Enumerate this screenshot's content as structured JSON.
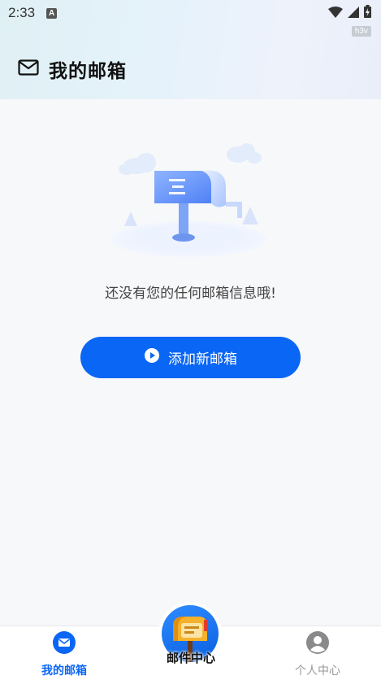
{
  "status_bar": {
    "time": "2:33",
    "notification_badge": "A",
    "watermark": "h3v"
  },
  "header": {
    "title": "我的邮箱",
    "icon": "envelope-icon"
  },
  "empty_state": {
    "illustration": "mailbox-illustration",
    "message": "还没有您的任何邮箱信息哦!"
  },
  "add_button": {
    "icon": "play-circle-icon",
    "label": "添加新邮箱"
  },
  "bottom_nav": {
    "items": [
      {
        "label": "我的邮箱",
        "icon": "mail-tab-icon",
        "active": true
      },
      {
        "label": "邮件中心",
        "icon": "mailbox-fab-icon",
        "active": false
      },
      {
        "label": "个人中心",
        "icon": "user-avatar-icon",
        "active": false
      }
    ]
  },
  "colors": {
    "accent": "#0a66f5",
    "inactive": "#999999",
    "background": "#f7f8fa"
  }
}
